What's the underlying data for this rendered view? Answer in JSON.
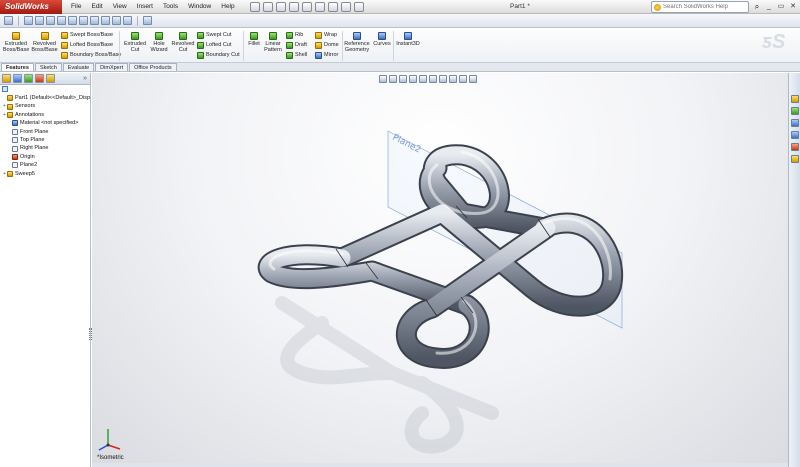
{
  "app": {
    "logo": "SolidWorks",
    "document_title": "Part1 *"
  },
  "menu": [
    "File",
    "Edit",
    "View",
    "Insert",
    "Tools",
    "Window",
    "Help"
  ],
  "search": {
    "placeholder": "Search SolidWorks Help"
  },
  "window_controls": {
    "minimize": "_",
    "restore": "▭",
    "close": "✕"
  },
  "ribbon": {
    "extruded_boss": "Extruded Boss/Base",
    "revolved_boss": "Revolved Boss/Base",
    "swept_boss": "Swept Boss/Base",
    "lofted_boss": "Lofted Boss/Base",
    "boundary_boss": "Boundary Boss/Base",
    "extruded_cut": "Extruded Cut",
    "hole_wizard": "Hole Wizard",
    "revolved_cut": "Revolved Cut",
    "swept_cut": "Swept Cut",
    "lofted_cut": "Lofted Cut",
    "boundary_cut": "Boundary Cut",
    "fillet": "Fillet",
    "linear_pattern": "Linear Pattern",
    "rib": "Rib",
    "draft": "Draft",
    "shell": "Shell",
    "wrap": "Wrap",
    "dome": "Dome",
    "mirror": "Mirror",
    "reference_geometry": "Reference Geometry",
    "curves": "Curves",
    "instant3d": "Instant3D"
  },
  "tabs": [
    "Features",
    "Sketch",
    "Evaluate",
    "DimXpert",
    "Office Products"
  ],
  "tree": [
    {
      "label": "Part1  (Default<<Default>_Disp",
      "expander": ""
    },
    {
      "label": "Sensors",
      "expander": "+"
    },
    {
      "label": "Annotations",
      "expander": "+"
    },
    {
      "label": "Material <not specified>",
      "expander": ""
    },
    {
      "label": "Front Plane",
      "expander": ""
    },
    {
      "label": "Top Plane",
      "expander": ""
    },
    {
      "label": "Right Plane",
      "expander": ""
    },
    {
      "label": "Origin",
      "expander": ""
    },
    {
      "label": "Plane2",
      "expander": ""
    },
    {
      "label": "Sweep5",
      "expander": "+"
    }
  ],
  "viewport": {
    "plane_label": "Plane2",
    "view_orientation": "*Isometric"
  },
  "pane_arrows": "»"
}
